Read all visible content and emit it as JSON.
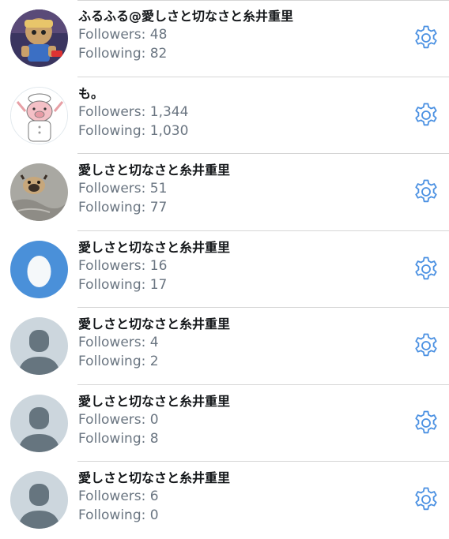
{
  "accounts": [
    {
      "name": "ふるふる@愛しさと切なさと糸井重里",
      "followers_label": "Followers: 48",
      "following_label": "Following: 82",
      "avatar": "character-figurine-photo"
    },
    {
      "name": "も。",
      "followers_label": "Followers: 1,344",
      "following_label": "Following: 1,030",
      "avatar": "pig-chef-drawing"
    },
    {
      "name": "愛しさと切なさと糸井重里",
      "followers_label": "Followers: 51",
      "following_label": "Following: 77",
      "avatar": "pug-dog-photo"
    },
    {
      "name": "愛しさと切なさと糸井重里",
      "followers_label": "Followers: 16",
      "following_label": "Following: 17",
      "avatar": "default-egg"
    },
    {
      "name": "愛しさと切なさと糸井重里",
      "followers_label": "Followers: 4",
      "following_label": "Following: 2",
      "avatar": "default-person"
    },
    {
      "name": "愛しさと切なさと糸井重里",
      "followers_label": "Followers: 0",
      "following_label": "Following: 8",
      "avatar": "default-person"
    },
    {
      "name": "愛しさと切なさと糸井重里",
      "followers_label": "Followers: 6",
      "following_label": "Following: 0",
      "avatar": "default-person"
    }
  ],
  "icons": {
    "settings": "gear-icon"
  },
  "colors": {
    "accent": "#4a90e2",
    "egg_background": "#4a90d9",
    "default_avatar_background": "#ccd6dd",
    "default_avatar_figure": "#66757f",
    "name_text": "#14171a",
    "secondary_text": "#6a7581",
    "divider": "#d5d5d5"
  }
}
